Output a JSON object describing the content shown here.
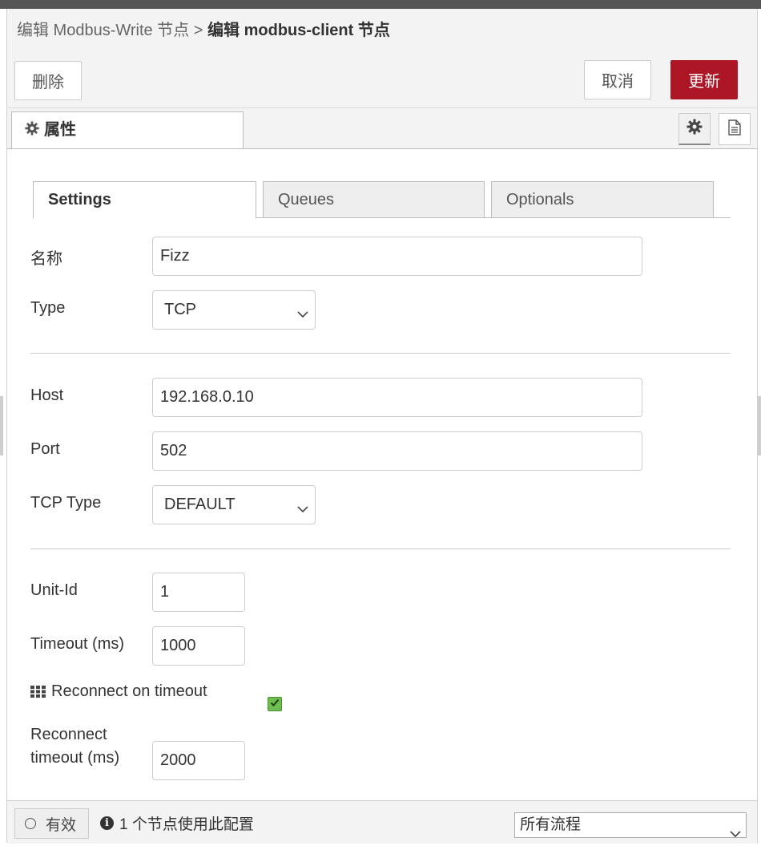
{
  "breadcrumb": {
    "previous": "编辑 Modbus-Write 节点",
    "separator": ">",
    "current": "编辑 modbus-client 节点"
  },
  "toolbar": {
    "delete_label": "删除",
    "cancel_label": "取消",
    "update_label": "更新"
  },
  "tabs": {
    "properties_label": "属性",
    "icons": [
      "gear-icon",
      "document-icon"
    ]
  },
  "subtabs": [
    "Settings",
    "Queues",
    "Optionals"
  ],
  "form": {
    "name_label": "名称",
    "name_value": "Fizz",
    "type_label": "Type",
    "type_value": "TCP",
    "host_label": "Host",
    "host_value": "192.168.0.10",
    "port_label": "Port",
    "port_value": "502",
    "tcp_type_label": "TCP Type",
    "tcp_type_value": "DEFAULT",
    "unit_id_label": "Unit-Id",
    "unit_id_value": "1",
    "timeout_label": "Timeout (ms)",
    "timeout_value": "1000",
    "reconnect_label": "Reconnect on timeout",
    "reconnect_checked": true,
    "reconnect_timeout_label_1": "Reconnect",
    "reconnect_timeout_label_2": "timeout (ms)",
    "reconnect_timeout_value": "2000"
  },
  "footer": {
    "enabled_label": "有效",
    "usage_text": "1 个节点使用此配置",
    "scope_value": "所有流程"
  },
  "colors": {
    "primary": "#ad1625",
    "checkbox": "#6cbf4f",
    "header_bg": "#f3f3f3"
  }
}
